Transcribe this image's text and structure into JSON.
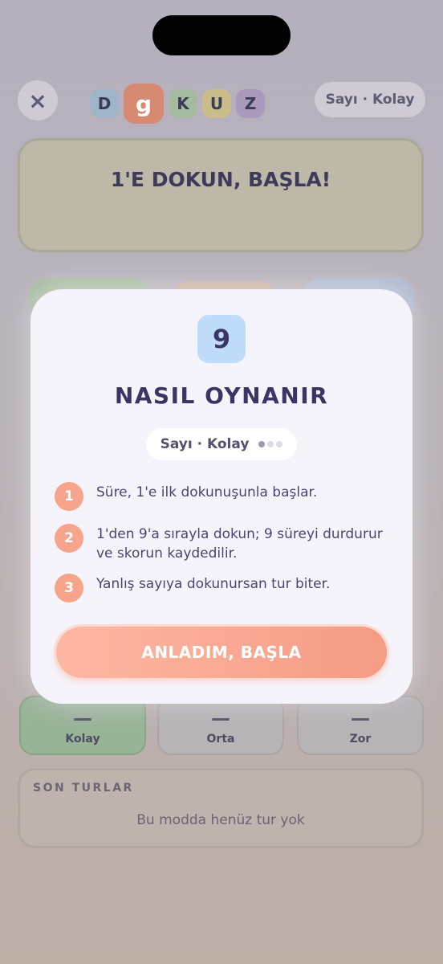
{
  "header": {
    "close_icon": "×",
    "logo_letters": [
      "D",
      "g",
      "K",
      "U",
      "Z"
    ],
    "mode_label": "Sayı · Kolay"
  },
  "start_card": {
    "text": "1'E DOKUN, BAŞLA!"
  },
  "difficulties": [
    {
      "label": "Kolay",
      "value": "—",
      "selected": true,
      "color": "#98b496"
    },
    {
      "label": "Orta",
      "value": "—",
      "selected": false
    },
    {
      "label": "Zor",
      "value": "—",
      "selected": false
    }
  ],
  "recent": {
    "title": "SON TURLAR",
    "empty_text": "Bu modda henüz tur yok"
  },
  "modal": {
    "badge": "9",
    "title": "NASIL OYNANIR",
    "sub_label": "Sayı · Kolay",
    "page_indicator": {
      "total": 3,
      "current": 1
    },
    "steps": [
      {
        "num": "1",
        "text": "Süre, 1'e ilk dokunuşunla başlar."
      },
      {
        "num": "2",
        "text": "1'den 9'a sırayla dokun; 9 süreyi durdurur ve skorun kaydedilir."
      },
      {
        "num": "3",
        "text": "Yanlış sayıya dokunursan tur biter."
      }
    ],
    "cta_label": "ANLADIM, BAŞLA",
    "accent_color": "#f6a48c",
    "badge_color": "#bfdcfb"
  }
}
